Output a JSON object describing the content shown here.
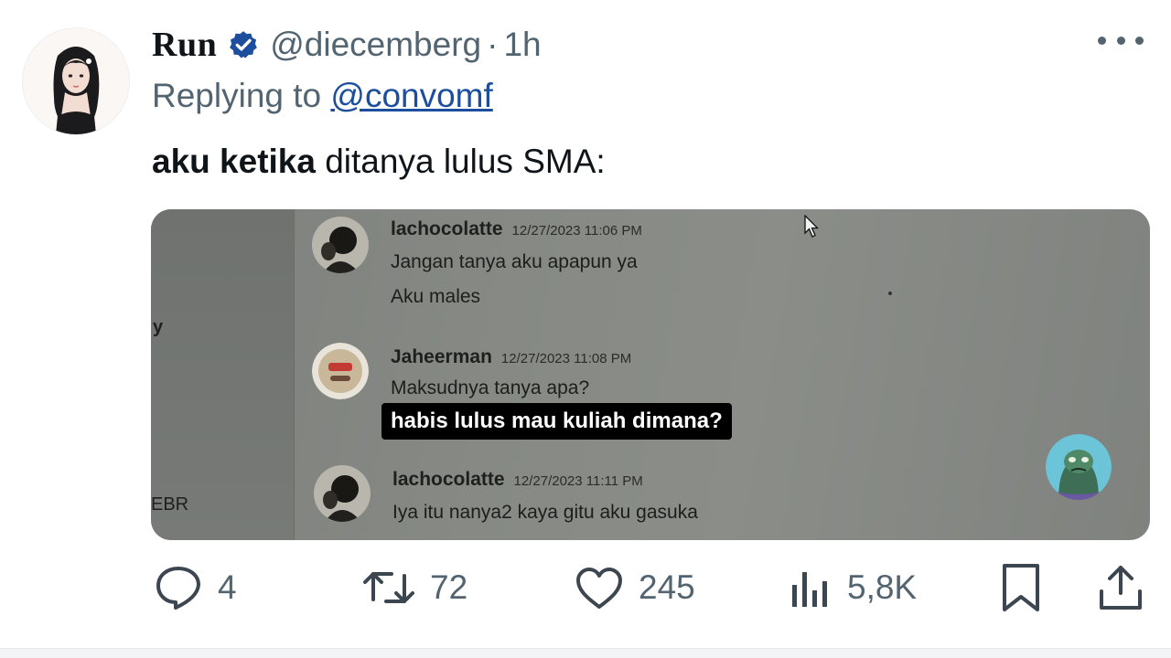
{
  "tweet": {
    "display_name": "Run",
    "handle": "@diecemberg",
    "separator": "·",
    "time": "1h",
    "replying_prefix": "Replying to",
    "replying_to": "@convomf",
    "text_bold": "aku ketika",
    "text_rest": " ditanya lulus SMA:"
  },
  "media": {
    "left_panel_y": "y",
    "left_panel_ebr": "EBR",
    "messages": [
      {
        "user": "lachocolatte",
        "timestamp": "12/27/2023 11:06 PM",
        "lines": [
          "Jangan tanya aku apapun ya",
          "Aku males"
        ]
      },
      {
        "user": "Jaheerman",
        "timestamp": "12/27/2023 11:08 PM",
        "lines": [
          "Maksudnya tanya apa?"
        ]
      },
      {
        "user": "lachocolatte",
        "timestamp": "12/27/2023 11:11 PM",
        "lines": [
          "Iya itu nanya2 kaya gitu aku gasuka"
        ]
      }
    ],
    "caption": "habis lulus mau kuliah dimana?"
  },
  "actions": {
    "replies": "4",
    "retweets": "72",
    "likes": "245",
    "views": "5,8K"
  },
  "icons": {
    "verified": "verified-badge-icon",
    "more": "more-options-icon",
    "reply": "reply-icon",
    "retweet": "retweet-icon",
    "like": "heart-icon",
    "views": "views-chart-icon",
    "bookmark": "bookmark-icon",
    "share": "share-icon"
  },
  "colors": {
    "text_primary": "#0f1419",
    "text_secondary": "#536471",
    "link": "#1d4e9e",
    "verified": "#1d4e9e"
  }
}
